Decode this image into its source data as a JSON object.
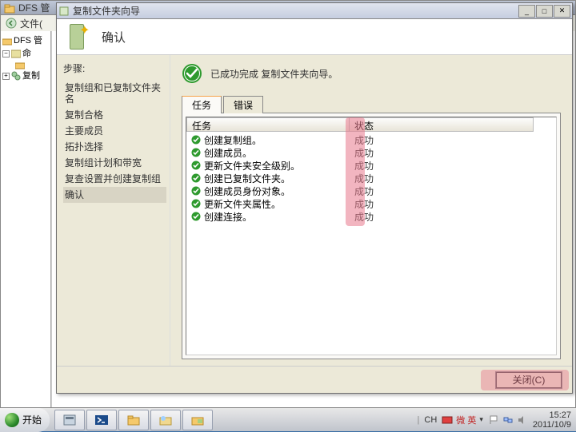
{
  "parent_window": {
    "title": "DFS 管",
    "menu_file": "文件(",
    "tree_header": "DFS 管",
    "tree_nodes": [
      {
        "sign": "−",
        "label": "命",
        "indent": 0
      },
      {
        "sign": "",
        "label": "",
        "indent": 1
      },
      {
        "sign": "+",
        "label": "复制",
        "indent": 0
      }
    ]
  },
  "wizard": {
    "title": "复制文件夹向导",
    "header_title": "确认",
    "steps_header": "步骤:",
    "steps": [
      "复制组和已复制文件夹名",
      "复制合格",
      "主要成员",
      "拓扑选择",
      "复制组计划和带宽",
      "复查设置并创建复制组",
      "确认"
    ],
    "selected_step_index": 6,
    "success_message": "已成功完成 复制文件夹向导。",
    "tabs": {
      "tasks": "任务",
      "errors": "错误"
    },
    "list": {
      "col_task": "任务",
      "col_status": "状态",
      "col_task_width": 204,
      "col_status_width": 230,
      "rows": [
        {
          "task": "创建复制组。",
          "status": "成功"
        },
        {
          "task": "创建成员。",
          "status": "成功"
        },
        {
          "task": "更新文件夹安全级别。",
          "status": "成功"
        },
        {
          "task": "创建已复制文件夹。",
          "status": "成功"
        },
        {
          "task": "创建成员身份对象。",
          "status": "成功"
        },
        {
          "task": "更新文件夹属性。",
          "status": "成功"
        },
        {
          "task": "创建连接。",
          "status": "成功"
        }
      ]
    },
    "close_label": "关闭(C)"
  },
  "taskbar": {
    "start_label": "开始",
    "lang_ch": "CH",
    "lang_cn": "微 英",
    "time": "15:27",
    "date": "2011/10/9"
  },
  "colors": {
    "success_green": "#2e9a2e",
    "highlight": "#e8788c"
  }
}
